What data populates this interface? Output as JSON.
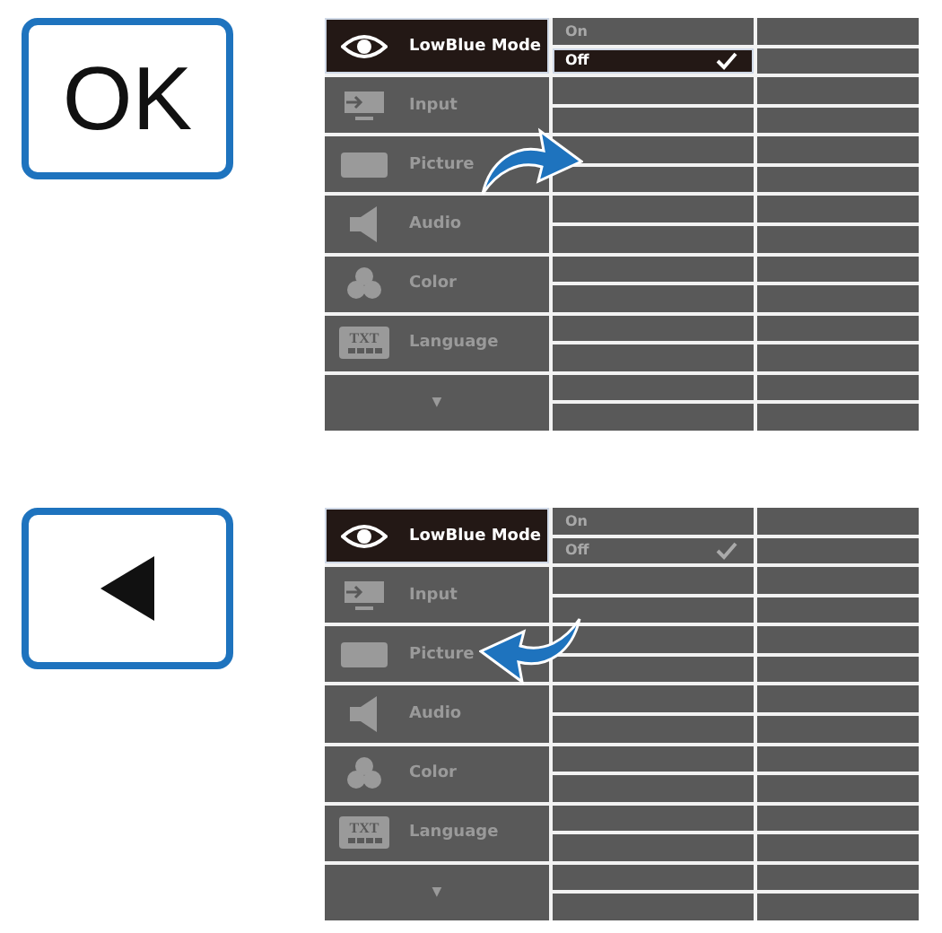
{
  "panels": [
    {
      "key": {
        "kind": "text",
        "label": "OK"
      },
      "arrow": {
        "kind": "forward"
      },
      "menu": {
        "items": [
          {
            "kind": "eye",
            "label": "LowBlue Mode",
            "selected": true
          },
          {
            "kind": "input",
            "label": "Input",
            "selected": false
          },
          {
            "kind": "picture",
            "label": "Picture",
            "selected": false
          },
          {
            "kind": "audio",
            "label": "Audio",
            "selected": false
          },
          {
            "kind": "color",
            "label": "Color",
            "selected": false
          },
          {
            "kind": "language",
            "label": "Language",
            "icon_text": "TXT",
            "selected": false
          }
        ],
        "scroll_label": "▼",
        "options": [
          {
            "label": "On",
            "selected": false,
            "checked": false
          },
          {
            "label": "Off",
            "selected": true,
            "checked": true
          }
        ]
      }
    },
    {
      "key": {
        "kind": "back"
      },
      "arrow": {
        "kind": "backward"
      },
      "menu": {
        "items": [
          {
            "kind": "eye",
            "label": "LowBlue Mode",
            "selected": true
          },
          {
            "kind": "input",
            "label": "Input",
            "selected": false
          },
          {
            "kind": "picture",
            "label": "Picture",
            "selected": false
          },
          {
            "kind": "audio",
            "label": "Audio",
            "selected": false
          },
          {
            "kind": "color",
            "label": "Color",
            "selected": false
          },
          {
            "kind": "language",
            "label": "Language",
            "icon_text": "TXT",
            "selected": false
          }
        ],
        "scroll_label": "▼",
        "options": [
          {
            "label": "On",
            "selected": false,
            "checked": false
          },
          {
            "label": "Off",
            "selected": false,
            "checked": true
          }
        ]
      }
    }
  ]
}
